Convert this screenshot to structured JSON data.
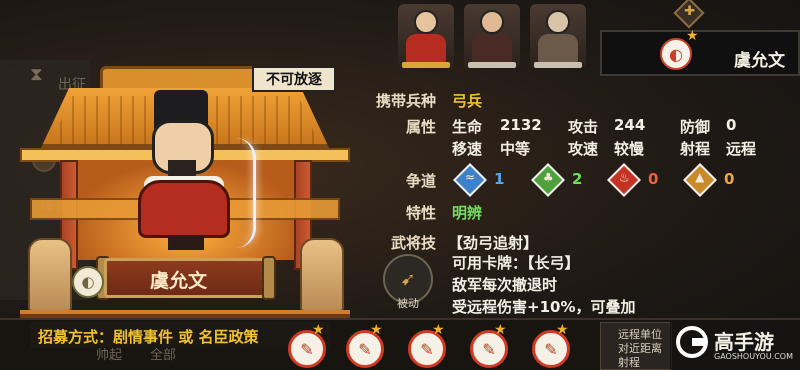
{
  "game": {
    "background": {
      "faint_left_top": "出征",
      "faint_left_mid": "兵",
      "faint_left_bottom": "阵容",
      "faint_bottom_left": "帅起",
      "faint_bottom_mid": "全部"
    },
    "right_card": {
      "hero_name": "虞允文"
    },
    "shrine": {
      "nameplate": "虞允文",
      "exile_tag": "不可放逐"
    },
    "info": {
      "troop_label": "携带兵种",
      "troop_value": "弓兵",
      "attr_label": "属性",
      "hp_label": "生命",
      "hp_value": "2132",
      "atk_label": "攻击",
      "atk_value": "244",
      "def_label": "防御",
      "def_value": "0",
      "move_label": "移速",
      "move_value": "中等",
      "aspd_label": "攻速",
      "aspd_value": "较慢",
      "range_label": "射程",
      "range_value": "远程",
      "faction_label": "争道",
      "factions": [
        {
          "icon": "blue-wave-icon",
          "value": "1",
          "color": "#3d82c8"
        },
        {
          "icon": "green-leaf-icon",
          "value": "2",
          "color": "#4fa13b"
        },
        {
          "icon": "red-flame-icon",
          "value": "0",
          "color": "#c53324"
        },
        {
          "icon": "orange-mountain-icon",
          "value": "0",
          "color": "#c98a2a"
        }
      ],
      "trait_label": "特性",
      "trait_value": "明辨",
      "skill_label": "武将技",
      "skill_name": "【劲弓追射】",
      "card_line": "可用卡牌：【长弓】",
      "desc_1": "敌军每次撤退时",
      "desc_2": "受远程伤害+10%，可叠加",
      "passive_tag": "被动"
    },
    "bottom": {
      "recruit_text": "招募方式：剧情事件 或 名臣政策",
      "tooltip_1": "远程单位",
      "tooltip_2": "对近距离",
      "tooltip_3": "射程"
    },
    "watermark": {
      "name": "高手游",
      "url": "GAOSHOUYOU.COM"
    }
  }
}
